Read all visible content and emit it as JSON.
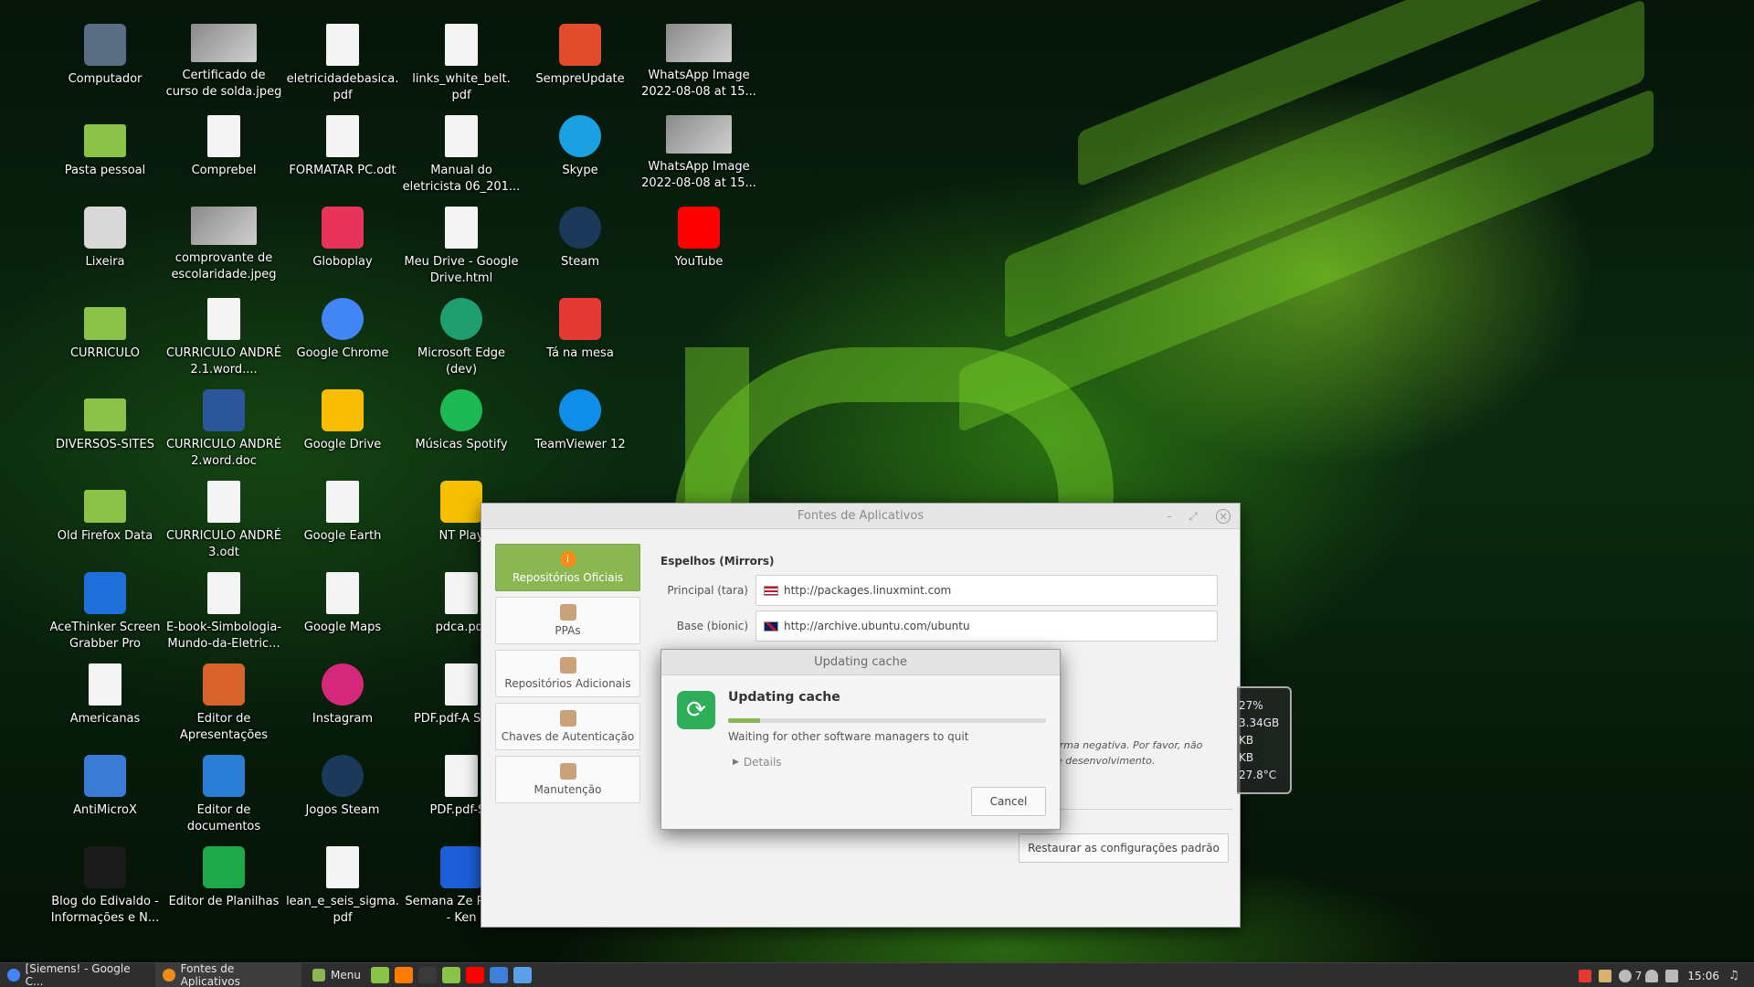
{
  "desktop": {
    "icons": [
      {
        "label": "Computador",
        "icon": "computer-icon",
        "color": "#5a6d82"
      },
      {
        "label": "Certificado de curso de solda.jpeg",
        "icon": "image-thumbnail",
        "color": "#a0a0a0"
      },
      {
        "label": "eletricidadebasica. pdf",
        "icon": "pdf-icon",
        "color": "#f4f4f4"
      },
      {
        "label": "links_white_belt. pdf",
        "icon": "pdf-icon",
        "color": "#f4f4f4"
      },
      {
        "label": "SempreUpdate",
        "icon": "sempreupdate-icon",
        "color": "#e24b2b"
      },
      {
        "label": "WhatsApp Image 2022-08-08 at 15...",
        "icon": "image-thumbnail",
        "color": "#a0a0a0"
      },
      {
        "label": "Pasta pessoal",
        "icon": "home-folder-icon",
        "color": "#8bc34a"
      },
      {
        "label": "Comprebel",
        "icon": "document-icon",
        "color": "#f4f4f4"
      },
      {
        "label": "FORMATAR PC.odt",
        "icon": "document-icon",
        "color": "#f4f4f4"
      },
      {
        "label": "Manual do eletricista 06_201...",
        "icon": "pdf-icon",
        "color": "#f4f4f4"
      },
      {
        "label": "Skype",
        "icon": "skype-icon",
        "color": "#1ba1e2"
      },
      {
        "label": "WhatsApp Image 2022-08-08 at 15...",
        "icon": "image-thumbnail",
        "color": "#a0a0a0"
      },
      {
        "label": "Lixeira",
        "icon": "trash-icon",
        "color": "#d8d8d8"
      },
      {
        "label": "comprovante de escolaridade.jpeg",
        "icon": "image-thumbnail",
        "color": "#a0a0a0"
      },
      {
        "label": "Globoplay",
        "icon": "globoplay-icon",
        "color": "#e8335a"
      },
      {
        "label": "Meu Drive - Google Drive.html",
        "icon": "html-icon",
        "color": "#f4f4f4"
      },
      {
        "label": "Steam",
        "icon": "steam-icon",
        "color": "#1b3a5a"
      },
      {
        "label": "YouTube",
        "icon": "youtube-icon",
        "color": "#ff0000"
      },
      {
        "label": "CURRICULO",
        "icon": "folder-icon",
        "color": "#8bc34a"
      },
      {
        "label": "CURRICULO ANDRÉ 2.1.word....",
        "icon": "document-icon",
        "color": "#f4f4f4"
      },
      {
        "label": "Google Chrome",
        "icon": "chrome-icon",
        "color": "#4285f4"
      },
      {
        "label": "Microsoft Edge (dev)",
        "icon": "edge-icon",
        "color": "#1f9e6f"
      },
      {
        "label": "Tá na mesa",
        "icon": "tanamesa-icon",
        "color": "#e53935"
      },
      {
        "label": "",
        "icon": "",
        "color": ""
      },
      {
        "label": "DIVERSOS-SITES",
        "icon": "folder-icon",
        "color": "#8bc34a"
      },
      {
        "label": "CURRICULO ANDRÉ 2.word.doc",
        "icon": "word-icon",
        "color": "#2b579a"
      },
      {
        "label": "Google Drive",
        "icon": "google-drive-icon",
        "color": "#fbbc04"
      },
      {
        "label": "Músicas Spotify",
        "icon": "spotify-icon",
        "color": "#1db954"
      },
      {
        "label": "TeamViewer 12",
        "icon": "teamviewer-icon",
        "color": "#0e8ee9"
      },
      {
        "label": "",
        "icon": "",
        "color": ""
      },
      {
        "label": "Old Firefox Data",
        "icon": "folder-icon",
        "color": "#8bc34a"
      },
      {
        "label": "CURRICULO ANDRÉ 3.odt",
        "icon": "document-icon",
        "color": "#f4f4f4"
      },
      {
        "label": "Google Earth",
        "icon": "document-icon",
        "color": "#f4f4f4"
      },
      {
        "label": "NT Play",
        "icon": "ntplay-icon",
        "color": "#f6c000"
      },
      {
        "label": "",
        "icon": "",
        "color": ""
      },
      {
        "label": "",
        "icon": "",
        "color": ""
      },
      {
        "label": "AceThinker Screen Grabber Pro",
        "icon": "acethinker-icon",
        "color": "#1e6fd9"
      },
      {
        "label": "E-book-Simbologia-Mundo-da-Eletric...",
        "icon": "pdf-icon",
        "color": "#f4f4f4"
      },
      {
        "label": "Google Maps",
        "icon": "document-icon",
        "color": "#f4f4f4"
      },
      {
        "label": "pdca.pdf",
        "icon": "pdf-icon",
        "color": "#f4f4f4"
      },
      {
        "label": "",
        "icon": "",
        "color": ""
      },
      {
        "label": "",
        "icon": "",
        "color": ""
      },
      {
        "label": "Americanas",
        "icon": "document-icon",
        "color": "#f4f4f4"
      },
      {
        "label": "Editor de Apresentações",
        "icon": "impress-icon",
        "color": "#d9642b"
      },
      {
        "label": "Instagram",
        "icon": "instagram-icon",
        "color": "#d6287a"
      },
      {
        "label": "PDF.pdf-A SENAI",
        "icon": "pdf-icon",
        "color": "#cde3f0"
      },
      {
        "label": "",
        "icon": "",
        "color": ""
      },
      {
        "label": "",
        "icon": "",
        "color": ""
      },
      {
        "label": "AntiMicroX",
        "icon": "gamepad-icon",
        "color": "#3a7bd5"
      },
      {
        "label": "Editor de documentos",
        "icon": "writer-icon",
        "color": "#2a7fd4"
      },
      {
        "label": "Jogos Steam",
        "icon": "steam-icon",
        "color": "#1b3a5a"
      },
      {
        "label": "PDF.pdf-SE",
        "icon": "pdf-icon",
        "color": "#cde3f0"
      },
      {
        "label": "",
        "icon": "",
        "color": ""
      },
      {
        "label": "",
        "icon": "",
        "color": ""
      },
      {
        "label": "Blog do Edivaldo - Informações e N...",
        "icon": "blog-icon",
        "color": "#1a1a1a"
      },
      {
        "label": "Editor de Planilhas",
        "icon": "calc-icon",
        "color": "#1fa84a"
      },
      {
        "label": "lean_e_seis_sigma. pdf",
        "icon": "pdf-icon",
        "color": "#f4f4f4"
      },
      {
        "label": "Semana Ze Python - Ken",
        "icon": "kenzie-icon",
        "color": "#1e5fd9"
      },
      {
        "label": "",
        "icon": "",
        "color": ""
      },
      {
        "label": "",
        "icon": "",
        "color": ""
      }
    ]
  },
  "window": {
    "title": "Fontes de Aplicativos",
    "sidebar": [
      {
        "label": "Repositórios Oficiais",
        "active": true
      },
      {
        "label": "PPAs",
        "active": false
      },
      {
        "label": "Repositórios Adicionais",
        "active": false
      },
      {
        "label": "Chaves de Autenticação",
        "active": false
      },
      {
        "label": "Manutenção",
        "active": false
      }
    ],
    "mirrors": {
      "section_title": "Espelhos (Mirrors)",
      "main_label": "Principal (tara)",
      "main_url": "http://packages.linuxmint.com",
      "base_label": "Base (bionic)",
      "base_url": "http://archive.ubuntu.com/ubuntu"
    },
    "partial_text_1": "forma negativa. Por favor, não",
    "partial_text_2": "de desenvolvimento.",
    "restore_label": "Restaurar as configurações padrão"
  },
  "desklet": {
    "lines": [
      "27%",
      "3.34GB",
      "KB",
      "KB",
      "27.8°C"
    ]
  },
  "dialog": {
    "title": "Updating cache",
    "heading": "Updating cache",
    "status": "Waiting for other software managers to quit",
    "details_label": "Details",
    "cancel_label": "Cancel",
    "progress": 0.1
  },
  "taskbar": {
    "tasks": [
      {
        "label": "[Siemens! - Google C...",
        "icon": "chrome-icon",
        "color": "#4285f4"
      },
      {
        "label": "Fontes de Aplicativos",
        "icon": "software-sources-icon",
        "color": "#f08c1a"
      }
    ],
    "menu_label": "Menu",
    "launchers": [
      {
        "icon": "files-icon",
        "color": "#8bc34a"
      },
      {
        "icon": "firefox-icon",
        "color": "#ff7a00"
      },
      {
        "icon": "terminal-icon",
        "color": "#3a3a3a"
      },
      {
        "icon": "folder-icon",
        "color": "#8bc34a"
      },
      {
        "icon": "youtube-icon",
        "color": "#ff0000"
      },
      {
        "icon": "edge-icon",
        "color": "#3d7fd9"
      },
      {
        "icon": "screenshot-icon",
        "color": "#5aa0e8"
      }
    ],
    "tray_count": "7",
    "clock": "15:06"
  }
}
